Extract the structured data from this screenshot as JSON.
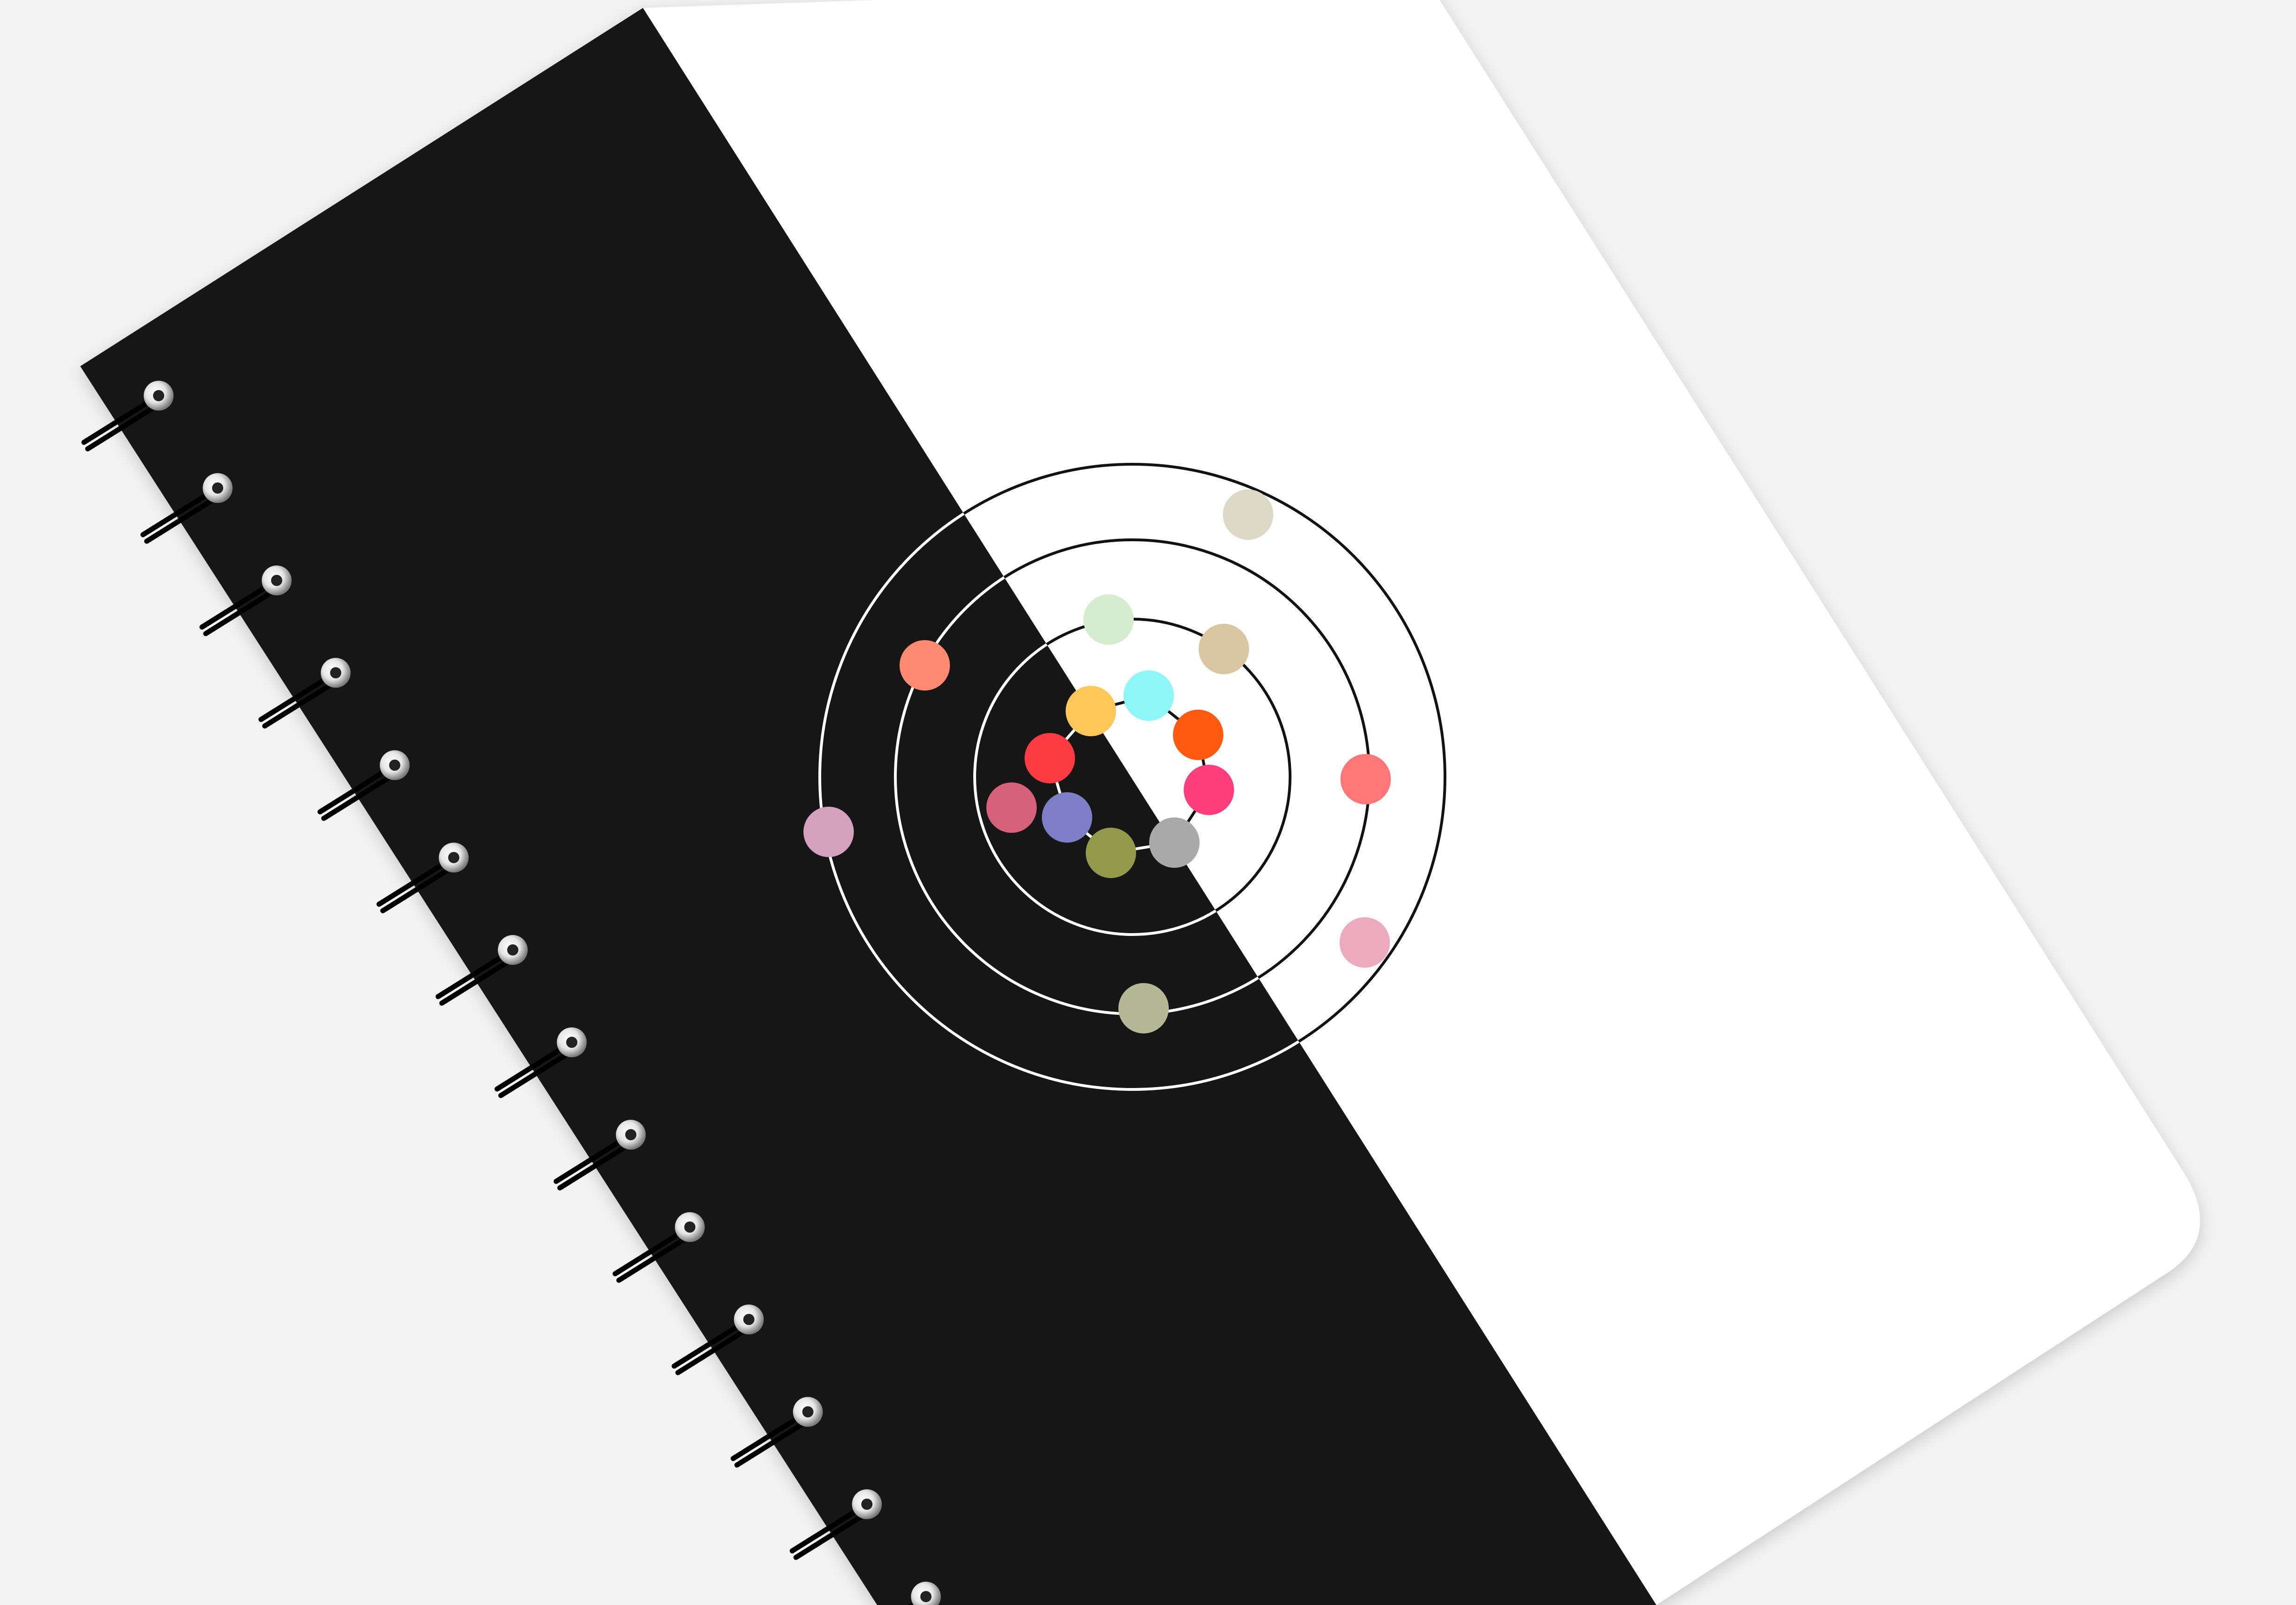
{
  "colors": {
    "background": "#f3f3f3",
    "cover_dark": "#121212",
    "cover_light": "#ffffff",
    "ring_line": "#121212",
    "binding_wire": "#000000"
  },
  "binding": {
    "ring_count": 14
  },
  "orbits": {
    "count": 4
  },
  "dots": {
    "innermost_ring": [
      "#ffc75a",
      "#8ff6f8",
      "#ff5a10",
      "#ff3f7d",
      "#a9a9a9",
      "#929a4a",
      "#7e7dc8",
      "#ff3b43"
    ],
    "second_ring": [
      "#d6ecce",
      "#dac5a3",
      "#d7607a"
    ],
    "third_ring": [
      "#ff8a72",
      "#ff7679",
      "#b4b895"
    ],
    "outer_ring": [
      "#ded8c6",
      "#d6a1bf",
      "#ebaabe"
    ]
  }
}
